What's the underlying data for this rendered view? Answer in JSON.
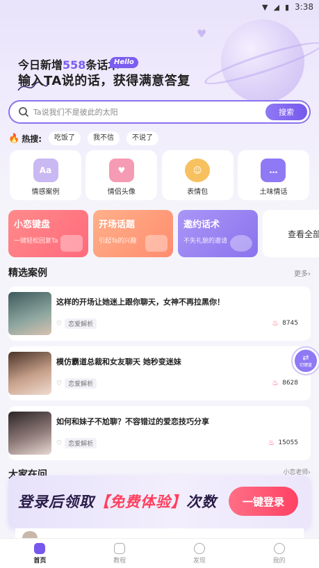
{
  "status_bar": {
    "time": "3:38"
  },
  "hero": {
    "line1_prefix": "今日新增",
    "line1_count": "558",
    "line1_suffix": "条话术",
    "badge": "Hello",
    "line2": "输入TA说的话，获得满意答复"
  },
  "search": {
    "placeholder": "Ta说我们不是彼此的太阳",
    "button": "搜索"
  },
  "hot": {
    "label": "热搜:",
    "tags": [
      "吃饭了",
      "我不信",
      "不说了"
    ]
  },
  "categories": [
    {
      "label": "情感案例",
      "icon": "chat-aa-icon",
      "icon_text": "Aa",
      "color": "#c9b8f2"
    },
    {
      "label": "情侣头像",
      "icon": "heart-bubble-icon",
      "icon_text": "♥",
      "color": "#f59bb4"
    },
    {
      "label": "表情包",
      "icon": "emoji-face-icon",
      "icon_text": "☺",
      "color": "#f7c160"
    },
    {
      "label": "土味情话",
      "icon": "speech-bubble-icon",
      "icon_text": "…",
      "color": "#8f79f4"
    }
  ],
  "features": [
    {
      "title": "小恋键盘",
      "subtitle": "一键轻松回复Ta",
      "color_from": "#ff8a8a",
      "color_to": "#ff6a7c"
    },
    {
      "title": "开场话题",
      "subtitle": "引起Ta的兴趣",
      "color_from": "#ffb08a",
      "color_to": "#ff8c6e"
    },
    {
      "title": "邀约话术",
      "subtitle": "不失礼貌的邀请",
      "color_from": "#a996f6",
      "color_to": "#8a73ee"
    }
  ],
  "features_all": "查看全部",
  "cases_section": {
    "title": "精选案例",
    "more": "更多›"
  },
  "cases": [
    {
      "title": "这样的开场让她迷上跟你聊天，女神不再拉黑你！",
      "tag": "恋爱解析",
      "likes": "8745"
    },
    {
      "title": "模仿霸道总裁和女友聊天 她秒变迷妹",
      "tag": "恋爱解析",
      "likes": "8628"
    },
    {
      "title": "如何和妹子不尬聊？不容错过的爱恋技巧分享",
      "tag": "恋爱解析",
      "likes": "15055"
    }
  ],
  "switch_fab": {
    "label": "切键盘"
  },
  "ask_section": {
    "title": "大家在问",
    "more": "小恋老师›"
  },
  "login_banner": {
    "text_prefix": "登录后领取",
    "text_highlight": "【免费体验】",
    "text_suffix": "次数",
    "button": "一键登录"
  },
  "tabs": [
    {
      "label": "首页",
      "active": true
    },
    {
      "label": "教程",
      "active": false
    },
    {
      "label": "发现",
      "active": false
    },
    {
      "label": "我的",
      "active": false
    }
  ]
}
